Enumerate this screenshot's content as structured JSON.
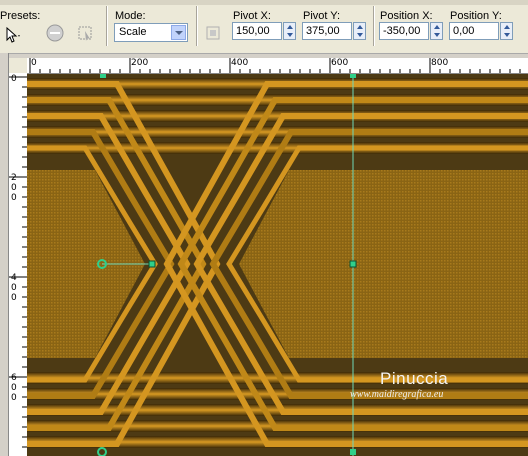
{
  "toolbar": {
    "presets_label": "Presets:",
    "mode_label": "Mode:",
    "mode_value": "Scale",
    "pivot_x_label": "Pivot X:",
    "pivot_x_value": "150,00",
    "pivot_y_label": "Pivot Y:",
    "pivot_y_value": "375,00",
    "position_x_label": "Position X:",
    "position_x_value": "-350,00",
    "position_y_label": "Position Y:",
    "position_y_value": "0,00"
  },
  "rulers": {
    "h_labels": [
      "0",
      "200",
      "400",
      "600",
      "800"
    ],
    "v_labels": [
      "0",
      "200",
      "400",
      "600"
    ]
  },
  "watermark": {
    "name": "Pinuccia",
    "url": "www.maidiregrafica.eu"
  },
  "colors": {
    "gold": "#c8901e",
    "dark": "#3a2a10",
    "bg": "#5a4418",
    "handle": "#2fd08a"
  }
}
